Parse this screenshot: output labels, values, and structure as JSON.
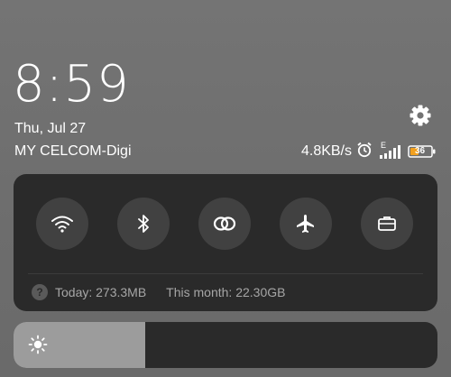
{
  "lockscreen": {
    "time": "8:59",
    "date": "Thu, Jul 27",
    "carrier": "MY CELCOM-Digi"
  },
  "status_bar": {
    "network_speed": "4.8KB/s",
    "network_type": "E",
    "battery_percent": "36",
    "icons": [
      "alarm-icon",
      "signal-icon",
      "battery-icon"
    ],
    "battery_color": "#f2a01e"
  },
  "quick_settings": {
    "toggles": [
      {
        "name": "wifi",
        "icon": "wifi-icon",
        "active": false
      },
      {
        "name": "bluetooth",
        "icon": "bluetooth-icon",
        "active": false
      },
      {
        "name": "hotspot",
        "icon": "hotspot-icon",
        "active": false
      },
      {
        "name": "airplane-mode",
        "icon": "airplane-icon",
        "active": false
      },
      {
        "name": "work-profile",
        "icon": "briefcase-icon",
        "active": false
      }
    ],
    "data_usage": {
      "today": "Today: 273.3MB",
      "month": "This month: 22.30GB"
    }
  },
  "brightness": {
    "level": 0.31,
    "icon": "brightness-icon"
  },
  "colors": {
    "panel": "#2a2a2a",
    "toggle_bg": "#414141",
    "brightness_fill": "#9c9c9c"
  }
}
